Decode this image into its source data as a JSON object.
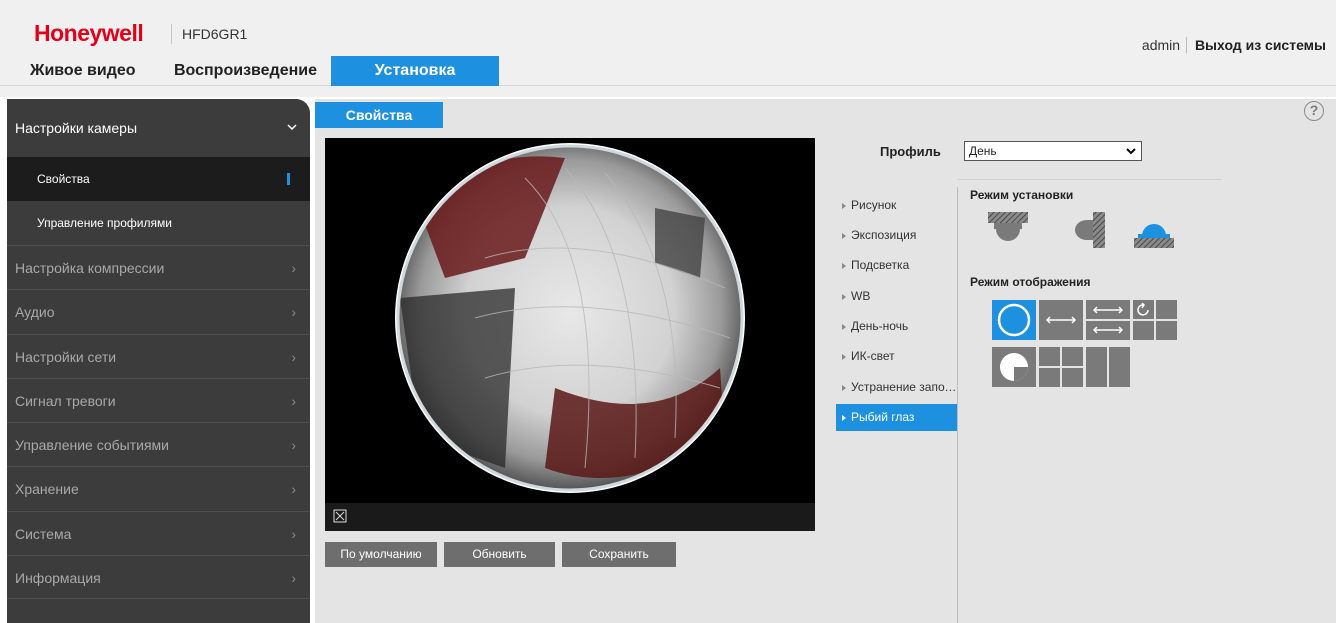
{
  "header": {
    "logo": "Honeywell",
    "model": "HFD6GR1",
    "user": "admin",
    "logout": "Выход из системы"
  },
  "topnav": [
    {
      "label": "Живое видео"
    },
    {
      "label": "Воспроизведение"
    },
    {
      "label": "Установка",
      "active": true
    }
  ],
  "sidebar": {
    "group_label": "Настройки камеры",
    "sub_items": [
      {
        "label": "Свойства",
        "active": true
      },
      {
        "label": "Управление профилями"
      }
    ],
    "items": [
      {
        "label": "Настройка компрессии"
      },
      {
        "label": "Аудио"
      },
      {
        "label": "Настройки сети"
      },
      {
        "label": "Сигнал тревоги"
      },
      {
        "label": "Управление событиями"
      },
      {
        "label": "Хранение"
      },
      {
        "label": "Система"
      },
      {
        "label": "Информация"
      }
    ]
  },
  "content": {
    "tab_title": "Свойства",
    "help": "?",
    "profile_label": "Профиль",
    "profile_value": "День",
    "buttons": {
      "default": "По умолчанию",
      "refresh": "Обновить",
      "save": "Сохранить"
    },
    "menu": [
      {
        "label": "Рисунок"
      },
      {
        "label": "Экспозиция"
      },
      {
        "label": "Подсветка"
      },
      {
        "label": "WB"
      },
      {
        "label": "День-ночь"
      },
      {
        "label": "ИК-свет"
      },
      {
        "label": "Устранение запотевания"
      },
      {
        "label": "Рыбий глаз",
        "active": true
      }
    ],
    "mount_mode_title": "Режим установки",
    "display_mode_title": "Режим отображения",
    "mount_icons": [
      "ceiling-mount-icon",
      "wall-mount-icon",
      "desk-mount-icon"
    ],
    "display_icons": [
      "fisheye-icon",
      "panorama-icon",
      "double-panorama-icon",
      "panorama-plus-three-icon",
      "fisheye-plus-three-icon",
      "quad-view-icon",
      "dual-view-icon"
    ]
  },
  "colors": {
    "accent": "#1e90e0",
    "brand": "#e3001b",
    "sidebar": "#3c3c3c",
    "content_bg": "#e4e4e4"
  }
}
